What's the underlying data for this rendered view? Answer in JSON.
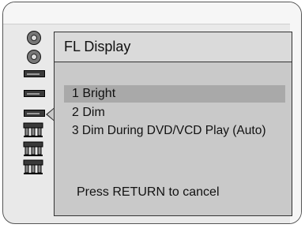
{
  "menu": {
    "title": "FL Display",
    "options": [
      {
        "label": "1 Bright",
        "selected": true
      },
      {
        "label": "2 Dim",
        "selected": false
      },
      {
        "label": "3 Dim During DVD/VCD Play (Auto)",
        "selected": false
      }
    ],
    "hint": "Press RETURN to cancel"
  },
  "sidebar": {
    "icons": [
      "disc-icon",
      "disc-icon",
      "player-deck-icon",
      "player-deck-icon",
      "player-deck-icon",
      "av-plug-icon",
      "av-plug-icon",
      "av-plug-icon"
    ],
    "selected_index": 4
  },
  "colors": {
    "frame_bg": "#e9e9e9",
    "panel_bg": "#c9c9c9",
    "highlight": "#a9a9a9"
  }
}
